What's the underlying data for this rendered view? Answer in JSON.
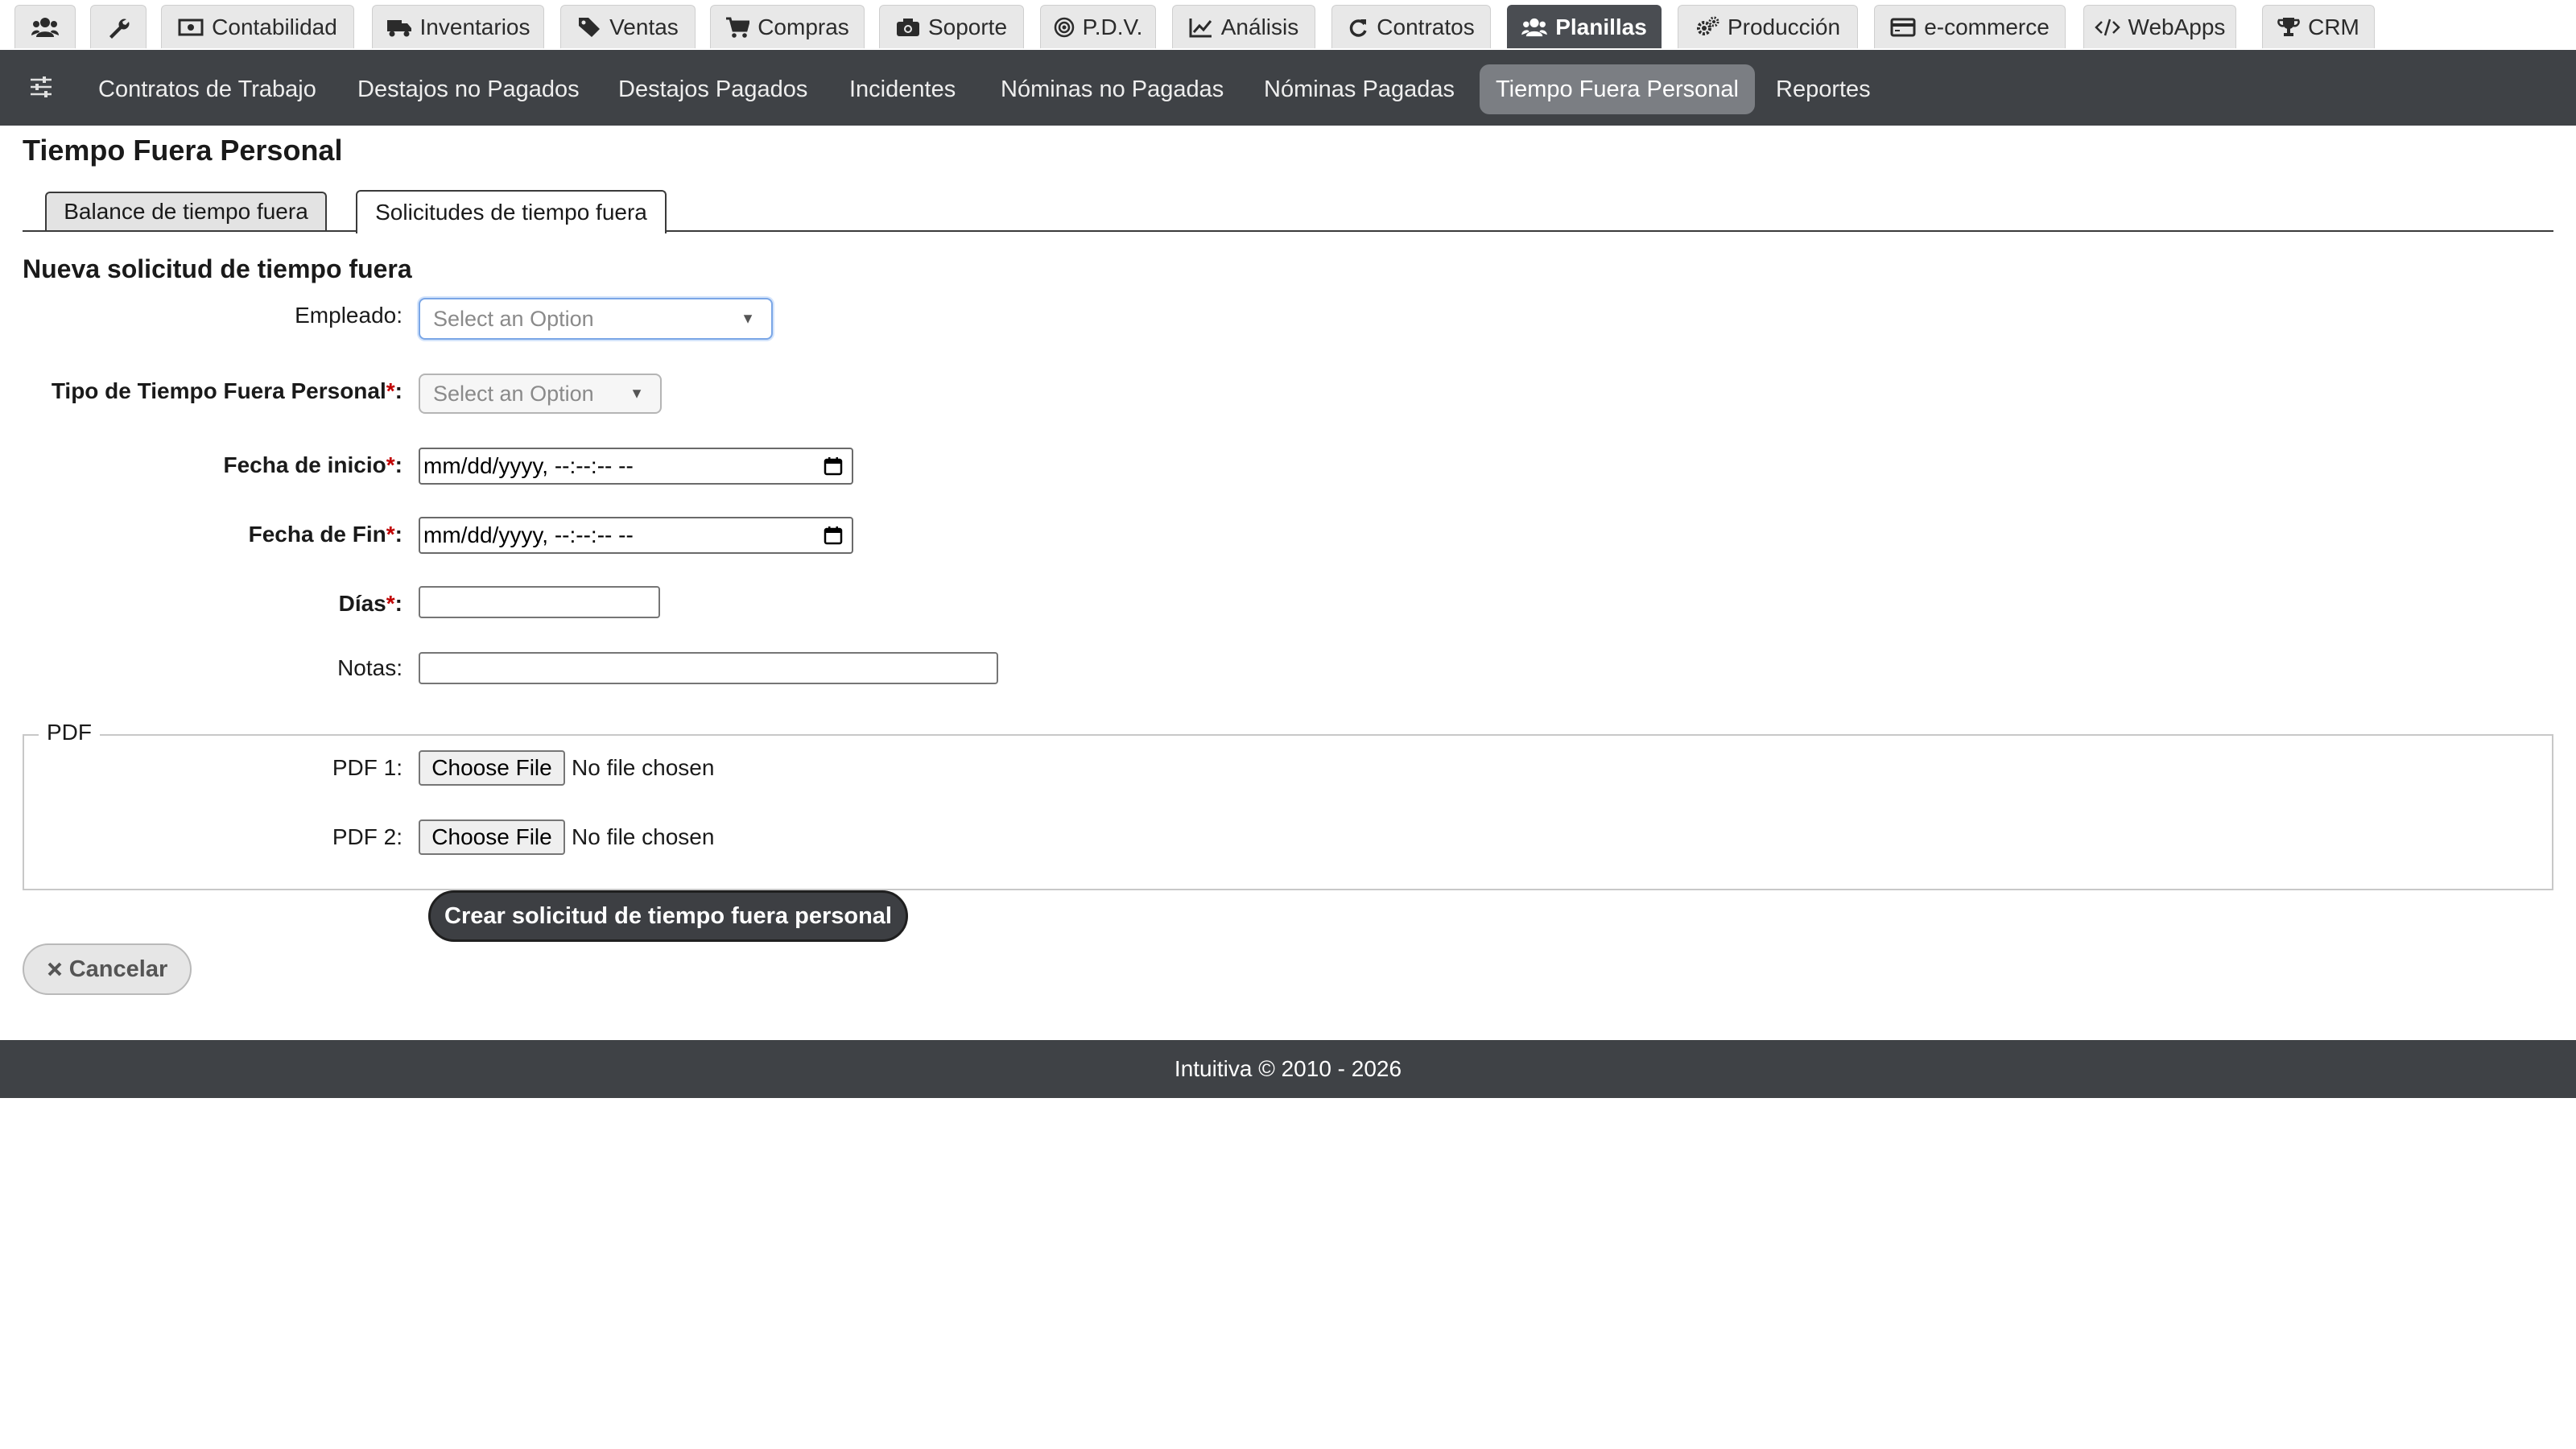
{
  "top_nav": {
    "tabs": [
      {
        "label": "",
        "icon": "users-icon"
      },
      {
        "label": "",
        "icon": "wrench-icon"
      },
      {
        "label": "Contabilidad",
        "icon": "money-icon"
      },
      {
        "label": "Inventarios",
        "icon": "truck-icon"
      },
      {
        "label": "Ventas",
        "icon": "tags-icon"
      },
      {
        "label": "Compras",
        "icon": "cart-icon"
      },
      {
        "label": "Soporte",
        "icon": "camera-icon"
      },
      {
        "label": "P.D.V.",
        "icon": "bullseye-icon"
      },
      {
        "label": "Análisis",
        "icon": "line-chart-icon"
      },
      {
        "label": "Contratos",
        "icon": "refresh-icon"
      },
      {
        "label": "Planillas",
        "icon": "users-icon"
      },
      {
        "label": "Producción",
        "icon": "gears-icon"
      },
      {
        "label": "e-commerce",
        "icon": "credit-card-icon"
      },
      {
        "label": "WebApps",
        "icon": "code-icon"
      },
      {
        "label": "CRM",
        "icon": "trophy-icon"
      }
    ],
    "active": "Planillas"
  },
  "sub_nav": {
    "toggle_icon": "sliders-icon",
    "items": [
      {
        "label": "Contratos de Trabajo"
      },
      {
        "label": "Destajos no Pagados"
      },
      {
        "label": "Destajos Pagados"
      },
      {
        "label": "Incidentes"
      },
      {
        "label": "Nóminas no Pagadas"
      },
      {
        "label": "Nóminas Pagadas"
      },
      {
        "label": "Tiempo Fuera Personal"
      },
      {
        "label": "Reportes"
      }
    ],
    "active": "Tiempo Fuera Personal"
  },
  "page": {
    "title": "Tiempo Fuera Personal",
    "tabs": [
      {
        "label": "Balance de tiempo fuera"
      },
      {
        "label": "Solicitudes de tiempo fuera"
      }
    ],
    "active_tab": "Solicitudes de tiempo fuera",
    "section_title": "Nueva solicitud de tiempo fuera"
  },
  "form": {
    "empleado": {
      "label": "Empleado:",
      "placeholder": "Select an Option",
      "value": ""
    },
    "tipo": {
      "label": "Tipo de Tiempo Fuera Personal",
      "required_mark": "*",
      "colon": ":",
      "placeholder": "Select an Option",
      "value": ""
    },
    "fecha_inicio": {
      "label": "Fecha de inicio",
      "required_mark": "*",
      "colon": ":",
      "placeholder": "mm/dd/yyyy, --:--:-- --",
      "value": ""
    },
    "fecha_fin": {
      "label": "Fecha de Fin",
      "required_mark": "*",
      "colon": ":",
      "placeholder": "mm/dd/yyyy, --:--:-- --",
      "value": ""
    },
    "dias": {
      "label": "Días",
      "required_mark": "*",
      "colon": ":",
      "value": ""
    },
    "notas": {
      "label": "Notas:",
      "value": ""
    },
    "pdf": {
      "legend": "PDF",
      "files": [
        {
          "label": "PDF 1:",
          "button": "Choose File",
          "status": "No file chosen"
        },
        {
          "label": "PDF 2:",
          "button": "Choose File",
          "status": "No file chosen"
        }
      ]
    },
    "submit_label": "Crear solicitud de tiempo fuera personal",
    "cancel_label": "Cancelar",
    "cancel_icon": "close-icon"
  },
  "footer": {
    "text": "Intuitiva © 2010 - 2026"
  }
}
